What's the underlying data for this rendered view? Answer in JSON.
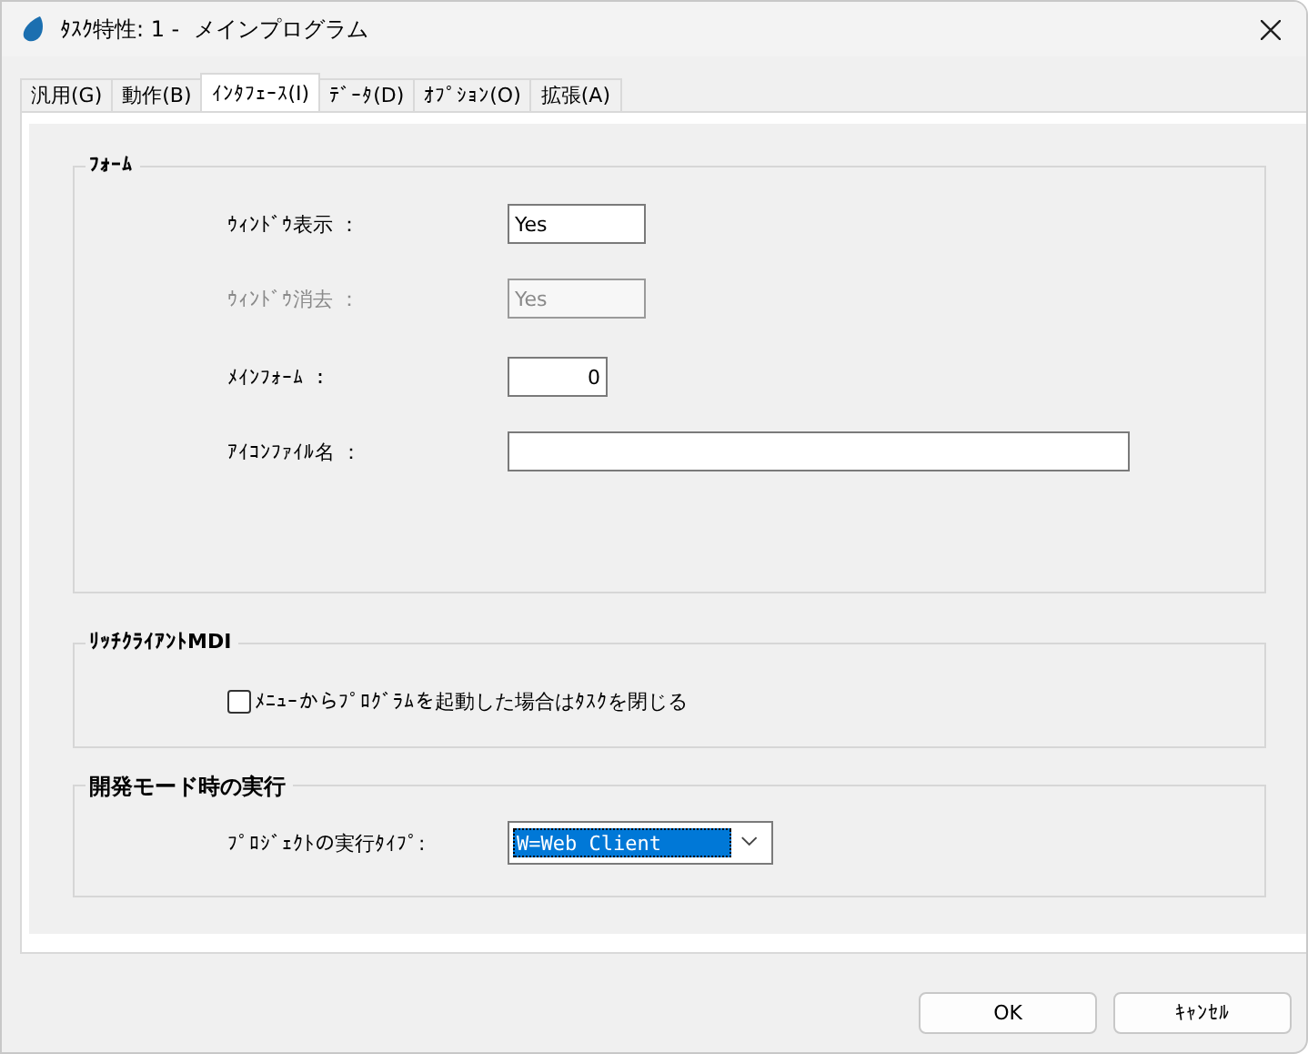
{
  "window": {
    "title": "ﾀｽｸ特性: 1 -  メインプログラム"
  },
  "tabs": [
    {
      "label": "汎用(G)",
      "selected": false
    },
    {
      "label": "動作(B)",
      "selected": false
    },
    {
      "label": "ｲﾝﾀﾌｪｰｽ(I)",
      "selected": true
    },
    {
      "label": "ﾃﾞｰﾀ(D)",
      "selected": false
    },
    {
      "label": "ｵﾌﾟｼｮﾝ(O)",
      "selected": false
    },
    {
      "label": "拡張(A)",
      "selected": false
    }
  ],
  "form_group": {
    "title": "ﾌｫｰﾑ",
    "fields": [
      {
        "label": "ｳｨﾝﾄﾞｳ表示 ：",
        "value": "Yes",
        "kind": "short",
        "disabled": false
      },
      {
        "label": "ｳｨﾝﾄﾞｳ消去 ：",
        "value": "Yes",
        "kind": "short",
        "disabled": true
      },
      {
        "label": "ﾒｲﾝﾌｫｰﾑ ：",
        "value": "0",
        "kind": "number",
        "disabled": false
      },
      {
        "label": "ｱｲｺﾝﾌｧｲﾙ名 ：",
        "kind": "long",
        "disabled": false
      }
    ]
  },
  "rich_client_group": {
    "title": "ﾘｯﾁｸﾗｲｱﾝﾄMDI",
    "checkbox": {
      "label": "ﾒﾆｭｰからﾌﾟﾛｸﾞﾗﾑを起動した場合はﾀｽｸを閉じる",
      "checked": false
    }
  },
  "dev_mode_group": {
    "title": "開発モード時の実行",
    "select": {
      "label": "ﾌﾟﾛｼﾞｪｸﾄの実行ﾀｲﾌﾟ:",
      "value": "W=Web Client"
    }
  },
  "buttons": [
    "OK",
    "ｷｬﾝｾﾙ"
  ]
}
